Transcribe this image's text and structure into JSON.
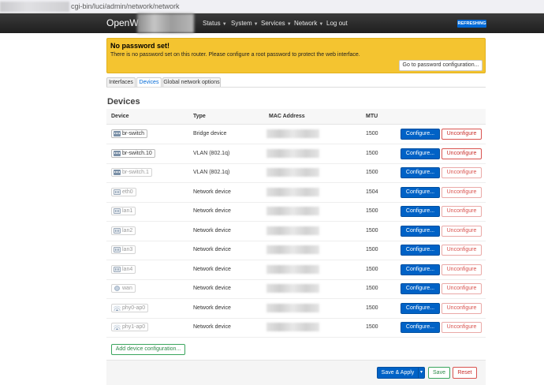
{
  "browser": {
    "url": "cgi-bin/luci/admin/network/network"
  },
  "header": {
    "brand": "OpenWr",
    "menu": [
      {
        "label": "Status"
      },
      {
        "label": "System"
      },
      {
        "label": "Services"
      },
      {
        "label": "Network"
      },
      {
        "label": "Log out"
      }
    ],
    "refresh_badge": "REFRESHING"
  },
  "alert": {
    "title": "No password set!",
    "text": "There is no password set on this router. Please configure a root password to protect the web interface.",
    "button": "Go to password configuration..."
  },
  "tabs": [
    {
      "label": "Interfaces",
      "active": false
    },
    {
      "label": "Devices",
      "active": true
    },
    {
      "label": "Global network options",
      "active": false
    }
  ],
  "section_title": "Devices",
  "table": {
    "headers": {
      "device": "Device",
      "type": "Type",
      "mac": "MAC Address",
      "mtu": "MTU"
    },
    "configure_label": "Configure...",
    "unconfigure_label": "Unconfigure",
    "rows": [
      {
        "device": "br-switch",
        "icon": "switch-icon",
        "type": "Bridge device",
        "mtu": "1500",
        "dim": false
      },
      {
        "device": "br-switch.10",
        "icon": "switch-icon",
        "type": "VLAN (802.1q)",
        "mtu": "1500",
        "dim": false
      },
      {
        "device": "br-switch.1",
        "icon": "switch-icon",
        "type": "VLAN (802.1q)",
        "mtu": "1500",
        "dim": true
      },
      {
        "device": "eth0",
        "icon": "ethernet-port-icon",
        "type": "Network device",
        "mtu": "1504",
        "dim": true
      },
      {
        "device": "lan1",
        "icon": "ethernet-port-icon",
        "type": "Network device",
        "mtu": "1500",
        "dim": true
      },
      {
        "device": "lan2",
        "icon": "ethernet-port-icon",
        "type": "Network device",
        "mtu": "1500",
        "dim": true
      },
      {
        "device": "lan3",
        "icon": "ethernet-port-icon",
        "type": "Network device",
        "mtu": "1500",
        "dim": true
      },
      {
        "device": "lan4",
        "icon": "ethernet-port-icon",
        "type": "Network device",
        "mtu": "1500",
        "dim": true
      },
      {
        "device": "wan",
        "icon": "wan-icon",
        "type": "Network device",
        "mtu": "1500",
        "dim": true
      },
      {
        "device": "phy0-ap0",
        "icon": "wifi-icon",
        "type": "Network device",
        "mtu": "1500",
        "dim": true
      },
      {
        "device": "phy1-ap0",
        "icon": "wifi-icon",
        "type": "Network device",
        "mtu": "1500",
        "dim": true
      }
    ]
  },
  "add_button": "Add device configuration...",
  "footer": {
    "save_apply": "Save & Apply",
    "dropdown_glyph": "▾",
    "save": "Save",
    "reset": "Reset"
  },
  "colors": {
    "primary": "#0062c6",
    "danger": "#d9534f",
    "success": "#3aa55d",
    "alert_bg": "#f4c430",
    "navbar": "#2a2a2a"
  }
}
